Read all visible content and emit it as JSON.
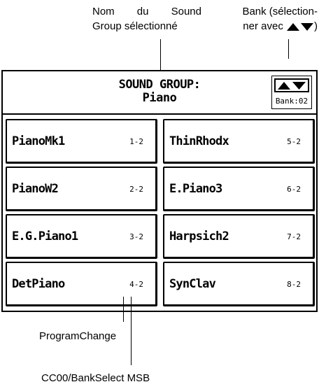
{
  "annotations": {
    "group_name_line1": "Nom du Sound",
    "group_name_line2": "Group sélectionné",
    "bank_line1": "Bank (sélection-",
    "bank_line2": "ner avec",
    "bank_close": ")",
    "program_change": "ProgramChange",
    "bank_select": "CC00/BankSelect MSB"
  },
  "header": {
    "title": "SOUND GROUP:",
    "group_name": "Piano"
  },
  "bank": {
    "label": "Bank:02",
    "icon": "up-down-arrows-icon"
  },
  "sounds": [
    {
      "name": "PianoMk1",
      "code": "1-2"
    },
    {
      "name": "ThinRhodx",
      "code": "5-2"
    },
    {
      "name": "PianoW2",
      "code": "2-2"
    },
    {
      "name": "E.Piano3",
      "code": "6-2"
    },
    {
      "name": "E.G.Piano1",
      "code": "3-2"
    },
    {
      "name": "Harpsich2",
      "code": "7-2"
    },
    {
      "name": "DetPiano",
      "code": "4-2"
    },
    {
      "name": "SynClav",
      "code": "8-2"
    }
  ],
  "colors": {
    "foreground": "#000000",
    "background": "#ffffff"
  }
}
